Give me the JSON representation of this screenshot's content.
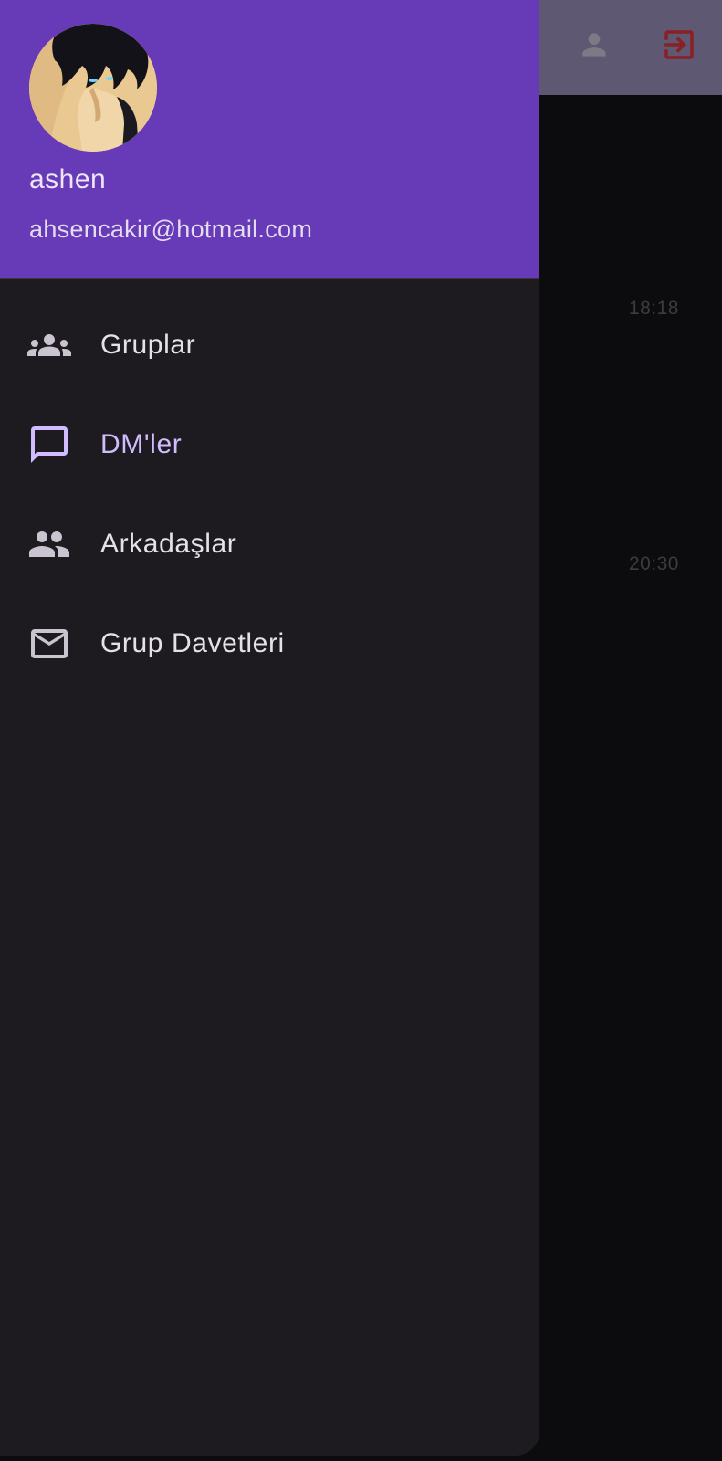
{
  "app_bar": {
    "actions": [
      {
        "name": "profile",
        "icon": "person-icon"
      },
      {
        "name": "logout",
        "icon": "exit-icon"
      }
    ]
  },
  "background_list": {
    "timestamps": [
      "18:18",
      "20:30"
    ]
  },
  "drawer": {
    "header": {
      "user_name": "ashen",
      "user_email": "ahsencakir@hotmail.com"
    },
    "items": [
      {
        "label": "Gruplar",
        "icon": "groups-icon",
        "selected": false
      },
      {
        "label": "DM'ler",
        "icon": "chat-bubble-icon",
        "selected": true
      },
      {
        "label": "Arkadaşlar",
        "icon": "people-icon",
        "selected": false
      },
      {
        "label": "Grup Davetleri",
        "icon": "mail-icon",
        "selected": false
      }
    ]
  },
  "colors": {
    "header_bg": "#673ab7",
    "drawer_bg": "#1d1b20",
    "selected_text": "#d0bcff",
    "logout_icon": "#8a1f24"
  }
}
